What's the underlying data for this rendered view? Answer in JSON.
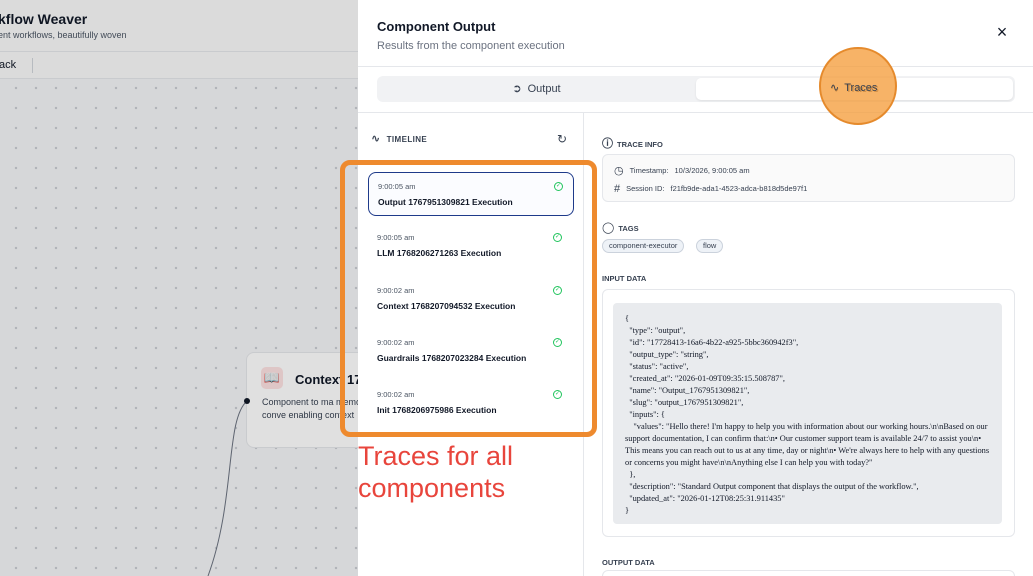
{
  "background": {
    "app_title": "kflow Weaver",
    "app_subtitle": "ent workflows, beautifully woven",
    "back_label": "ack",
    "node": {
      "title": "Context 17",
      "description": "Component to ma memory for conve enabling context"
    }
  },
  "panel": {
    "title": "Component Output",
    "subtitle": "Results from the component execution",
    "close_icon": "×",
    "tabs": [
      {
        "label": "Output",
        "icon": "output-icon",
        "active": false
      },
      {
        "label": "Traces",
        "icon": "activity-icon",
        "active": true
      }
    ]
  },
  "timeline": {
    "title": "TIMELINE",
    "items": [
      {
        "time": "9:00:05 am",
        "name": "Output 1767951309821 Execution",
        "status": "success"
      },
      {
        "time": "9:00:05 am",
        "name": "LLM 1768206271263 Execution",
        "status": "success"
      },
      {
        "time": "9:00:02 am",
        "name": "Context 1768207094532 Execution",
        "status": "success"
      },
      {
        "time": "9:00:02 am",
        "name": "Guardrails 1768207023284 Execution",
        "status": "success"
      },
      {
        "time": "9:00:02 am",
        "name": "Init 1768206975986 Execution",
        "status": "success"
      }
    ]
  },
  "trace_info": {
    "title": "TRACE INFO",
    "timestamp_label": "Timestamp:",
    "timestamp_value": "10/3/2026, 9:00:05 am",
    "session_label": "Session ID:",
    "session_value": "f21fb9de-ada1-4523-adca-b818d5de97f1"
  },
  "tags": {
    "title": "TAGS",
    "items": [
      "component-executor",
      "flow"
    ]
  },
  "input_data": {
    "title": "INPUT DATA",
    "json": "{\n  \"type\": \"output\",\n  \"id\": \"17728413-16a6-4b22-a925-5bbc360942f3\",\n  \"output_type\": \"string\",\n  \"status\": \"active\",\n  \"created_at\": \"2026-01-09T09:35:15.508787\",\n  \"name\": \"Output_1767951309821\",\n  \"slug\": \"output_1767951309821\",\n  \"inputs\": {\n    \"values\": \"Hello there! I'm happy to help you with information about our working hours.\\n\\nBased on our support documentation, I can confirm that:\\n• Our customer support team is available 24/7 to assist you\\n• This means you can reach out to us at any time, day or night\\n• We're always here to help with any questions or concerns you might have\\n\\nAnything else I can help you with today?\"\n  },\n  \"description\": \"Standard Output component that displays the output of the workflow.\",\n  \"updated_at\": \"2026-01-12T08:25:31.911435\"\n}"
  },
  "output_data": {
    "title": "OUTPUT DATA"
  },
  "annotation": {
    "callout_text": "Traces for all components",
    "highlight_color": "#ee8a2e",
    "text_color": "#e8453c"
  }
}
